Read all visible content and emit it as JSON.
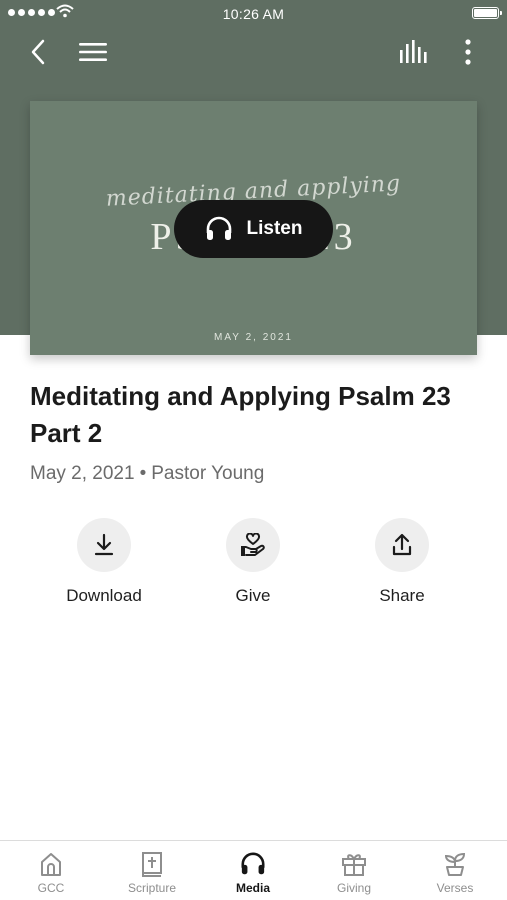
{
  "status_bar": {
    "time": "10:26 AM"
  },
  "header": {
    "back_icon": "chevron-left-icon",
    "menu_icon": "hamburger-menu-icon",
    "stats_icon": "bar-chart-icon",
    "more_icon": "vertical-ellipsis-icon"
  },
  "artwork": {
    "script_text": "meditating and applying",
    "title_text": "PSALM 23",
    "date_text": "MAY 2, 2021",
    "background_color": "#6d7f70"
  },
  "listen_button": {
    "label": "Listen",
    "icon": "headphones-icon"
  },
  "sermon": {
    "title": "Meditating and Applying Psalm 23 Part 2",
    "date": "May 2, 2021",
    "separator": "•",
    "speaker": "Pastor Young"
  },
  "actions": [
    {
      "label": "Download",
      "icon": "download-icon"
    },
    {
      "label": "Give",
      "icon": "giving-hand-heart-icon"
    },
    {
      "label": "Share",
      "icon": "share-icon"
    }
  ],
  "tab_bar": {
    "tabs": [
      {
        "label": "GCC",
        "icon": "church-icon",
        "active": false
      },
      {
        "label": "Scripture",
        "icon": "bible-icon",
        "active": false
      },
      {
        "label": "Media",
        "icon": "headphones-icon",
        "active": true
      },
      {
        "label": "Giving",
        "icon": "gift-icon",
        "active": false
      },
      {
        "label": "Verses",
        "icon": "plant-icon",
        "active": false
      }
    ]
  },
  "colors": {
    "header_background": "#5f6e62",
    "listen_pill": "#161616",
    "action_circle": "#eeeeee",
    "active_tab": "#161616",
    "inactive_tab": "#8e8e8e"
  }
}
